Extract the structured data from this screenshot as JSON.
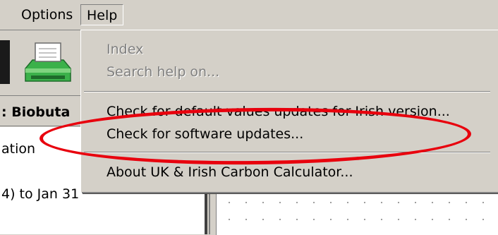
{
  "menubar": {
    "options_label": "Options",
    "help_label": "Help"
  },
  "panel": {
    "title": ": Biobuta",
    "line1": "ation",
    "line2": "4) to Jan 31"
  },
  "help_menu": {
    "items": [
      {
        "label": "Index",
        "enabled": false
      },
      {
        "label": "Search help on...",
        "enabled": false
      },
      {
        "label": "Check for default values updates for Irish version...",
        "enabled": true
      },
      {
        "label": "Check for software updates...",
        "enabled": true
      },
      {
        "label": "About UK & Irish Carbon Calculator...",
        "enabled": true
      }
    ]
  },
  "colors": {
    "face": "#d4d0c8",
    "disabled_text": "#808080",
    "annotation": "#e8000d"
  },
  "icons": [
    "printer-icon"
  ]
}
